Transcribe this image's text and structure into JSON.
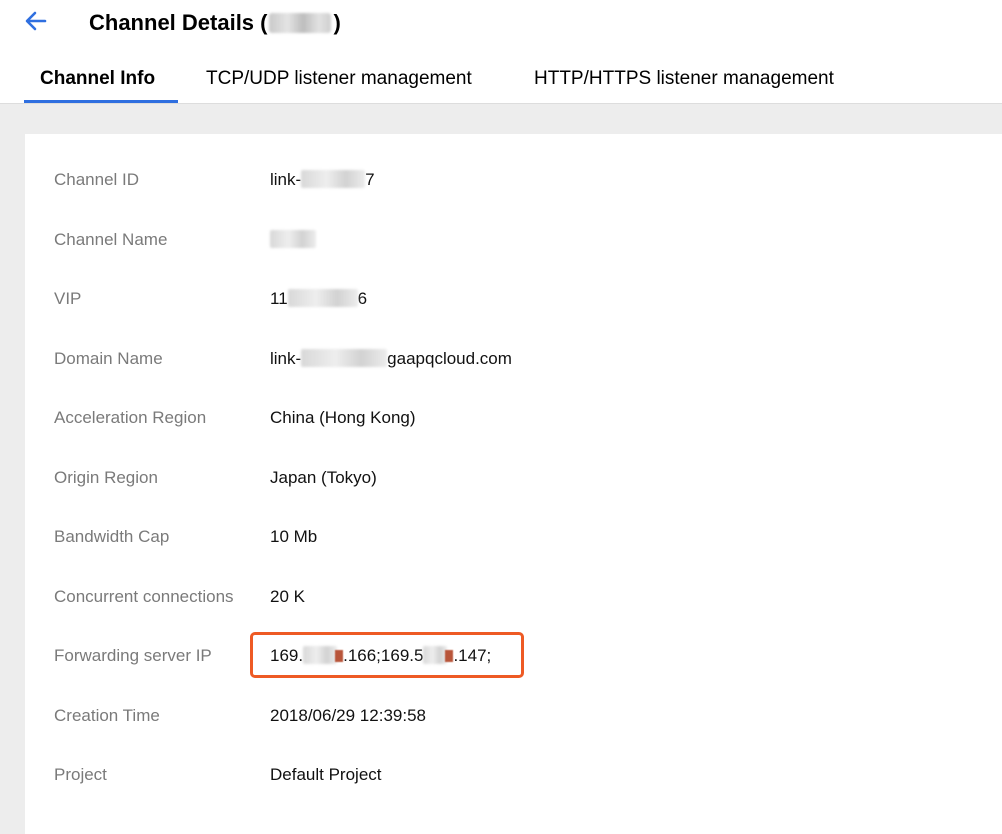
{
  "header": {
    "title": "Channel Details (",
    "title_close": ")"
  },
  "tabs": [
    {
      "label": "Channel Info",
      "active": true
    },
    {
      "label": "TCP/UDP listener management",
      "active": false
    },
    {
      "label": "HTTP/HTTPS listener management",
      "active": false
    }
  ],
  "details": {
    "channel_id": {
      "label": "Channel ID",
      "value_prefix": "link-",
      "value_suffix": "7"
    },
    "channel_name": {
      "label": "Channel Name"
    },
    "vip": {
      "label": "VIP",
      "value_prefix": "11",
      "value_suffix": "6"
    },
    "domain_name": {
      "label": "Domain Name",
      "value_prefix": "link-",
      "value_suffix": "gaapqcloud.com"
    },
    "acceleration_region": {
      "label": "Acceleration Region",
      "value": "China (Hong Kong)"
    },
    "origin_region": {
      "label": "Origin Region",
      "value": "Japan (Tokyo)"
    },
    "bandwidth_cap": {
      "label": "Bandwidth Cap",
      "value": "10 Mb"
    },
    "concurrent_connections": {
      "label": "Concurrent connections",
      "value": "20 K"
    },
    "forwarding_server_ip": {
      "label": "Forwarding server IP",
      "part1": "169.",
      "part2": ".166;169.5",
      "part3": ".147;"
    },
    "creation_time": {
      "label": "Creation Time",
      "value": "2018/06/29 12:39:58"
    },
    "project": {
      "label": "Project",
      "value": "Default Project"
    }
  },
  "colors": {
    "accent": "#2f6fe0",
    "highlight": "#ee5a24",
    "label": "#7a7a7a"
  }
}
